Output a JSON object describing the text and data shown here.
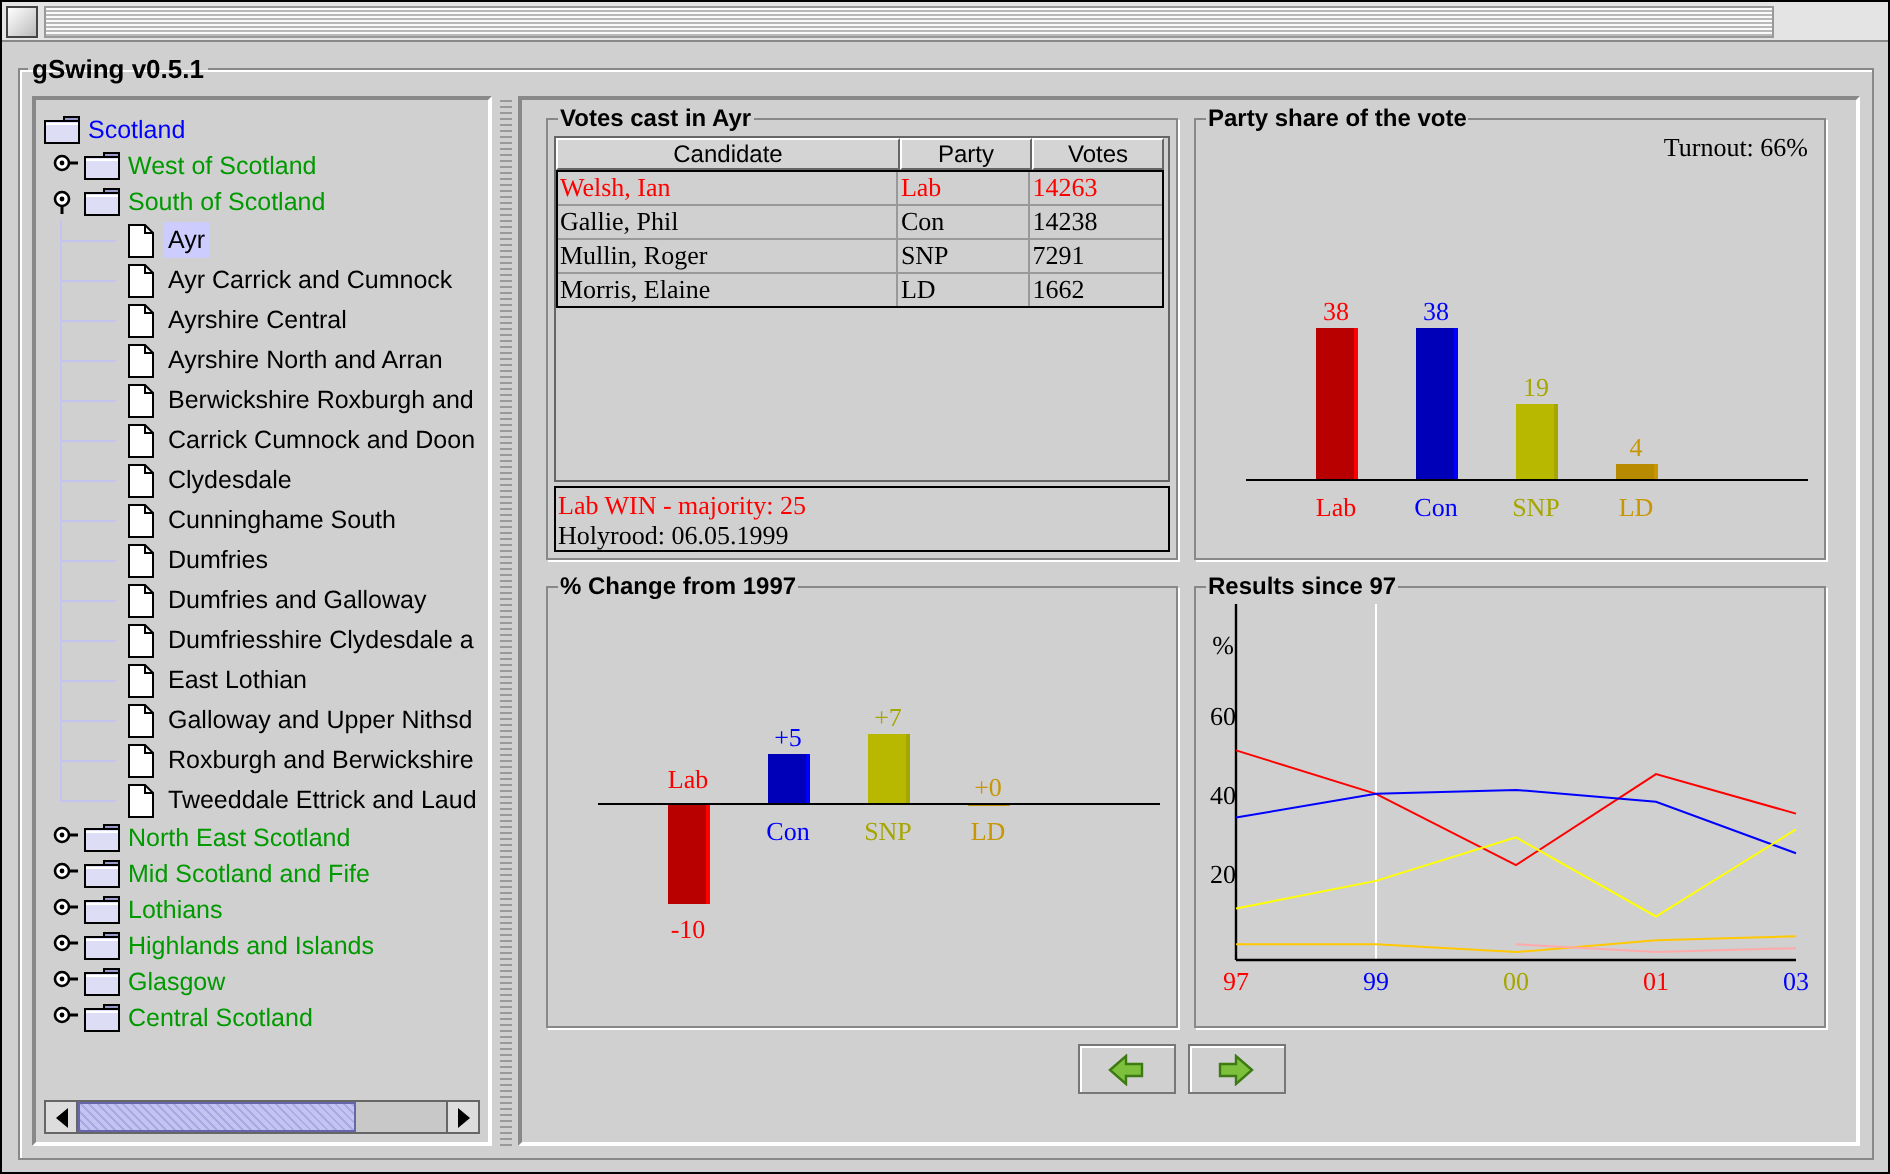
{
  "window": {
    "title": "gSwing v0.5.1"
  },
  "tree": [
    {
      "label": "Scotland",
      "kind": "root",
      "selected": false,
      "children": [
        {
          "label": "West of Scotland",
          "kind": "region",
          "expanded": false,
          "selected": false
        },
        {
          "label": "South of Scotland",
          "kind": "region",
          "expanded": true,
          "selected": false,
          "children": [
            {
              "label": "Ayr",
              "kind": "seat",
              "selected": true
            },
            {
              "label": "Ayr Carrick and Cumnock",
              "kind": "seat",
              "selected": false
            },
            {
              "label": "Ayrshire Central",
              "kind": "seat",
              "selected": false
            },
            {
              "label": "Ayrshire North and Arran",
              "kind": "seat",
              "selected": false
            },
            {
              "label": "Berwickshire Roxburgh and",
              "kind": "seat",
              "selected": false
            },
            {
              "label": "Carrick Cumnock and Doon",
              "kind": "seat",
              "selected": false
            },
            {
              "label": "Clydesdale",
              "kind": "seat",
              "selected": false
            },
            {
              "label": "Cunninghame South",
              "kind": "seat",
              "selected": false
            },
            {
              "label": "Dumfries",
              "kind": "seat",
              "selected": false
            },
            {
              "label": "Dumfries and Galloway",
              "kind": "seat",
              "selected": false
            },
            {
              "label": "Dumfriesshire Clydesdale a",
              "kind": "seat",
              "selected": false
            },
            {
              "label": "East Lothian",
              "kind": "seat",
              "selected": false
            },
            {
              "label": "Galloway and Upper Nithsd",
              "kind": "seat",
              "selected": false
            },
            {
              "label": "Roxburgh and Berwickshire",
              "kind": "seat",
              "selected": false
            },
            {
              "label": "Tweeddale Ettrick and Laud",
              "kind": "seat",
              "selected": false
            }
          ]
        },
        {
          "label": "North East Scotland",
          "kind": "region",
          "expanded": false,
          "selected": false
        },
        {
          "label": "Mid Scotland and Fife",
          "kind": "region",
          "expanded": false,
          "selected": false
        },
        {
          "label": "Lothians",
          "kind": "region",
          "expanded": false,
          "selected": false
        },
        {
          "label": "Highlands and Islands",
          "kind": "region",
          "expanded": false,
          "selected": false
        },
        {
          "label": "Glasgow",
          "kind": "region",
          "expanded": false,
          "selected": false
        },
        {
          "label": "Central Scotland",
          "kind": "region",
          "expanded": false,
          "selected": false
        }
      ]
    }
  ],
  "votes": {
    "title": "Votes cast in Ayr",
    "columns": [
      "Candidate",
      "Party",
      "Votes"
    ],
    "rows": [
      {
        "candidate": "Welsh, Ian",
        "party": "Lab",
        "votes": "14263",
        "winner": true
      },
      {
        "candidate": "Gallie, Phil",
        "party": "Con",
        "votes": "14238",
        "winner": false
      },
      {
        "candidate": "Mullin, Roger",
        "party": "SNP",
        "votes": "7291",
        "winner": false
      },
      {
        "candidate": "Morris, Elaine",
        "party": "LD",
        "votes": "1662",
        "winner": false
      }
    ],
    "result_lines": [
      {
        "text": "Lab WIN - majority: 25",
        "highlight": true
      },
      {
        "text": "Holyrood: 06.05.1999",
        "highlight": false
      }
    ]
  },
  "share": {
    "title": "Party share of the vote",
    "turnout": "Turnout: 66%",
    "chart_data": {
      "type": "bar",
      "categories": [
        "Lab",
        "Con",
        "SNP",
        "LD"
      ],
      "values": [
        38,
        38,
        19,
        4
      ],
      "data_labels": true
    }
  },
  "change": {
    "title": "% Change from 1997",
    "chart_data": {
      "type": "bar",
      "categories": [
        "Lab",
        "Con",
        "SNP",
        "LD"
      ],
      "values": [
        -10,
        5,
        7,
        0
      ],
      "value_labels": [
        "-10",
        "+5",
        "+7",
        "+0"
      ]
    }
  },
  "parties": [
    {
      "color": "#ff0000"
    },
    {
      "color": "#0000ff"
    },
    {
      "color": "#a6a600"
    },
    {
      "color": "#c89600"
    }
  ],
  "results": {
    "title": "Results since 97",
    "years": [
      {
        "color": "#ff0000"
      },
      {
        "color": "#0000ff"
      },
      {
        "color": "#a6a600"
      },
      {
        "color": "#ff0000"
      },
      {
        "color": "#0000ff"
      }
    ],
    "chart_data": {
      "type": "line",
      "ylabel": "%",
      "categories": [
        "97",
        "99",
        "00",
        "01",
        "03"
      ],
      "ylim": [
        -2,
        88
      ],
      "yticks": [
        20,
        40,
        60
      ],
      "series": [
        {
          "color": "#ff0000",
          "values": [
            51,
            40,
            22,
            45,
            35
          ]
        },
        {
          "color": "#0000ff",
          "values": [
            34,
            40,
            41,
            38,
            25
          ]
        },
        {
          "color": "#ffff00",
          "values": [
            11,
            18,
            29,
            9,
            31
          ]
        },
        {
          "color": "#ffc800",
          "values": [
            2,
            2,
            0,
            3,
            4
          ]
        },
        {
          "color": "#ffaaaa",
          "values": [
            null,
            null,
            2,
            0,
            1
          ]
        }
      ],
      "annotations": [
        {
          "x": "99"
        }
      ]
    }
  }
}
